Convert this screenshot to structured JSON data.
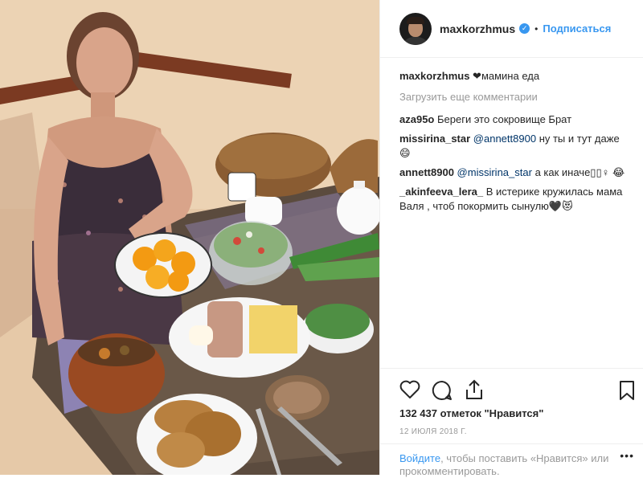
{
  "post": {
    "username": "maxkorzhmus",
    "verified_icon": "verified-badge-icon",
    "separator": "•",
    "follow_label": "Подписаться",
    "caption_user": "maxkorzhmus",
    "caption_text": "❤︎мамина еда",
    "load_more_label": "Загрузить еще комментарии"
  },
  "comments": [
    {
      "user": "aza95o",
      "mention": "",
      "text": "Береги это сокровище Брат"
    },
    {
      "user": "missirina_star",
      "mention": "@annett8900",
      "text": "ну ты и тут даже 😄"
    },
    {
      "user": "annett8900",
      "mention": "@missirina_star",
      "text": "а как иначе▯▯♀ 😂"
    },
    {
      "user": "_akinfeeva_lera_",
      "mention": "",
      "text": "В истерике кружилась мама Валя , чтоб покормить сынулю🖤😻"
    }
  ],
  "actions": {
    "icons": [
      "heart-icon",
      "comment-icon",
      "share-icon",
      "bookmark-icon"
    ]
  },
  "likes_text": "132 437 отметок \"Нравится\"",
  "date_text": "12 ИЮЛЯ 2018 Г.",
  "login": {
    "link": "Войдите",
    "text": ", чтобы поставить «Нравится» или прокомментировать.",
    "more_label": "•••"
  },
  "colors": {
    "link_blue": "#3897f0",
    "text": "#262626",
    "muted": "#999999",
    "mention": "#003569"
  }
}
